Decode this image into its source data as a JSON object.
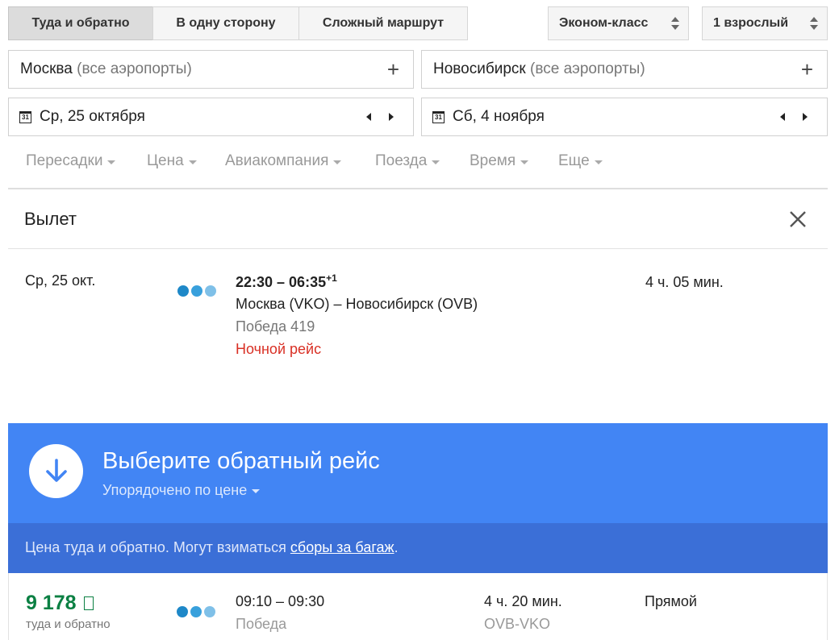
{
  "trip_type": {
    "round_trip": "Туда и обратно",
    "one_way": "В одну сторону",
    "multi_city": "Сложный маршрут"
  },
  "cabin": {
    "label": "Эконом-класс"
  },
  "passengers": {
    "label": "1 взрослый"
  },
  "origin": {
    "city": "Москва",
    "suffix": "(все аэропорты)"
  },
  "destination": {
    "city": "Новосибирск",
    "suffix": "(все аэропорты)"
  },
  "depart_date": {
    "icon_text": "31",
    "value": "Ср, 25 октября"
  },
  "return_date": {
    "icon_text": "31",
    "value": "Сб, 4 ноября"
  },
  "filters": [
    "Пересадки",
    "Цена",
    "Авиакомпания",
    "Поезда",
    "Время",
    "Еще"
  ],
  "departure": {
    "heading": "Вылет",
    "date": "Ср, 25 окт.",
    "times": "22:30 – 06:35",
    "day_offset": "+1",
    "route": "Москва (VKO) – Новосибирск (OVB)",
    "airline": "Победа 419",
    "note": "Ночной рейс",
    "duration": "4 ч. 05 мин."
  },
  "return_banner": {
    "title": "Выберите обратный рейс",
    "sort_label": "Упорядочено по цене",
    "info_text": "Цена туда и обратно. Могут взиматься ",
    "info_link": "сборы за багаж",
    "info_end": "."
  },
  "results": [
    {
      "price": "9 178",
      "currency_glyph": "⃀",
      "price_note": "туда и обратно",
      "times": "09:10 – 09:30",
      "airline": "Победа",
      "duration": "4 ч. 20 мин.",
      "route": "OVB-VKO",
      "stops": "Прямой"
    }
  ],
  "colors": {
    "accent_blue": "#4285f4",
    "dark_blue": "#3b6fd7",
    "price_green": "#0b8043",
    "warning_red": "#d93025",
    "dot_dark": "#1e88c8",
    "dot_mid": "#38a0dc",
    "dot_light": "#7fc0e8"
  }
}
